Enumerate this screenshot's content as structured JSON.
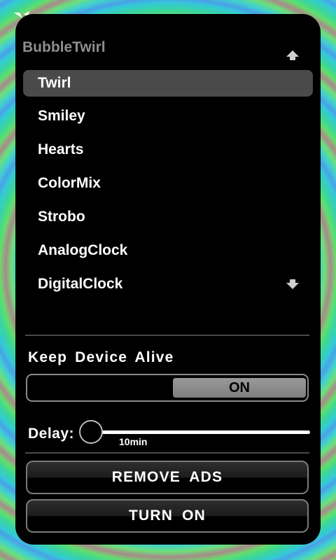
{
  "menu": {
    "header": "BubbleTwirl",
    "items": [
      "Twirl",
      "Smiley",
      "Hearts",
      "ColorMix",
      "Strobo",
      "AnalogClock",
      "DigitalClock"
    ],
    "selected_index": 0
  },
  "keep_alive": {
    "label": "Keep Device Alive",
    "state_label": "ON",
    "on": true
  },
  "delay": {
    "label": "Delay:",
    "value_label": "10min"
  },
  "buttons": {
    "remove_ads": "REMOVE ADS",
    "turn_on": "TURN ON"
  },
  "icons": {
    "scroll_up": "arrow-up-icon",
    "scroll_down": "arrow-down-icon"
  }
}
